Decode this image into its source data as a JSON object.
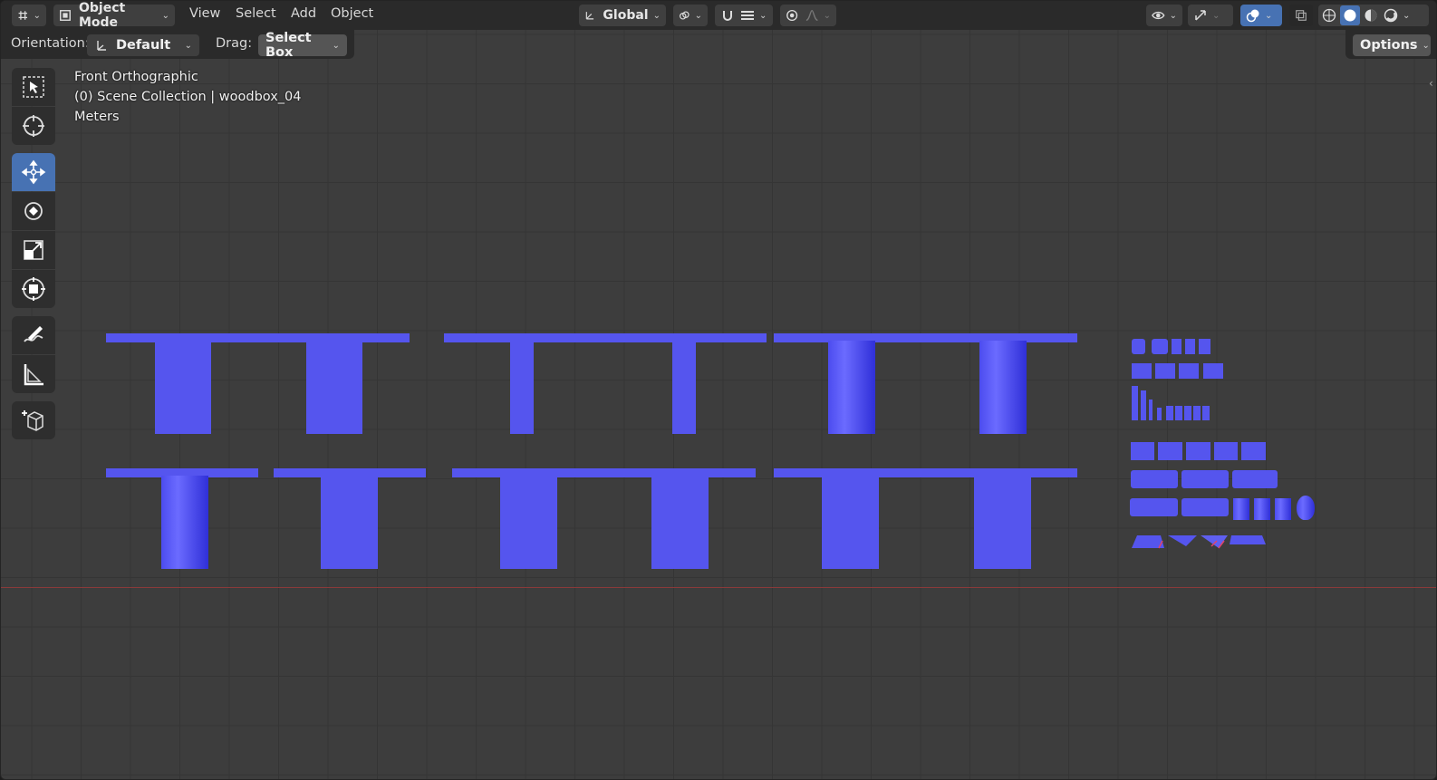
{
  "header": {
    "mode": "Object Mode",
    "menus": [
      "View",
      "Select",
      "Add",
      "Object"
    ],
    "transform_orientation": "Global"
  },
  "tool_settings": {
    "orientation_label": "Orientation:",
    "orientation_value": "Default",
    "drag_label": "Drag:",
    "drag_value": "Select Box",
    "options_label": "Options"
  },
  "overlay": {
    "view_name": "Front Orthographic",
    "collection": "(0) Scene Collection | woodbox_04",
    "units": "Meters"
  },
  "toolbar": {
    "items": [
      "select-box",
      "cursor",
      "move",
      "rotate",
      "scale",
      "transform",
      "annotate",
      "measure",
      "add-cube"
    ],
    "active": "move"
  },
  "colors": {
    "accent": "#4772b3",
    "object": "#5555ee",
    "x_axis": "#8a3a3a"
  }
}
